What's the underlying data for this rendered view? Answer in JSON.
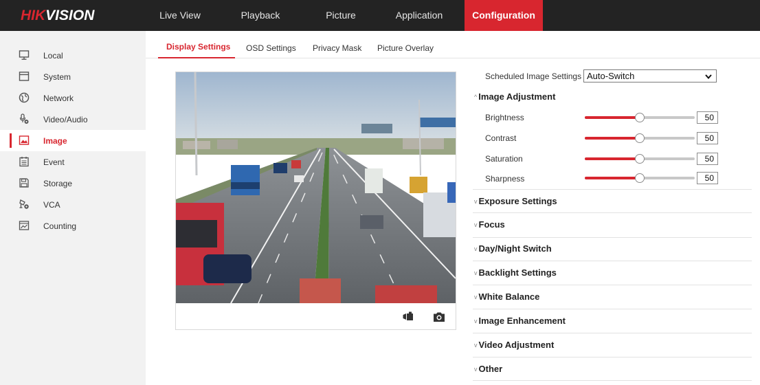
{
  "brand": {
    "logo_red": "HIK",
    "logo_white": "VISION",
    "accent": "#d8262f",
    "topbar_bg": "#232323"
  },
  "nav": [
    {
      "label": "Live View",
      "active": false
    },
    {
      "label": "Playback",
      "active": false
    },
    {
      "label": "Picture",
      "active": false
    },
    {
      "label": "Application",
      "active": false
    },
    {
      "label": "Configuration",
      "active": true
    }
  ],
  "sidebar": {
    "items": [
      {
        "label": "Local",
        "icon": "monitor-icon",
        "active": false
      },
      {
        "label": "System",
        "icon": "window-icon",
        "active": false
      },
      {
        "label": "Network",
        "icon": "globe-icon",
        "active": false
      },
      {
        "label": "Video/Audio",
        "icon": "microphone-icon",
        "active": false
      },
      {
        "label": "Image",
        "icon": "image-icon",
        "active": true
      },
      {
        "label": "Event",
        "icon": "calendar-icon",
        "active": false
      },
      {
        "label": "Storage",
        "icon": "floppy-disk-icon",
        "active": false
      },
      {
        "label": "VCA",
        "icon": "vca-camera-icon",
        "active": false
      },
      {
        "label": "Counting",
        "icon": "counting-chart-icon",
        "active": false
      }
    ]
  },
  "subtabs": [
    {
      "label": "Display Settings",
      "active": true
    },
    {
      "label": "OSD Settings",
      "active": false
    },
    {
      "label": "Privacy Mask",
      "active": false
    },
    {
      "label": "Picture Overlay",
      "active": false
    }
  ],
  "preview": {
    "tools": [
      "record-video-icon",
      "snapshot-camera-icon"
    ]
  },
  "settings": {
    "scheduled_label": "Scheduled Image Settings",
    "scheduled_value": "Auto-Switch",
    "image_adjustment": {
      "title": "Image Adjustment",
      "expanded": true,
      "sliders": [
        {
          "label": "Brightness",
          "value": "50",
          "fraction": 0.5
        },
        {
          "label": "Contrast",
          "value": "50",
          "fraction": 0.5
        },
        {
          "label": "Saturation",
          "value": "50",
          "fraction": 0.5
        },
        {
          "label": "Sharpness",
          "value": "50",
          "fraction": 0.5
        }
      ]
    },
    "sections": [
      "Exposure Settings",
      "Focus",
      "Day/Night Switch",
      "Backlight Settings",
      "White Balance",
      "Image Enhancement",
      "Video Adjustment",
      "Other"
    ]
  }
}
